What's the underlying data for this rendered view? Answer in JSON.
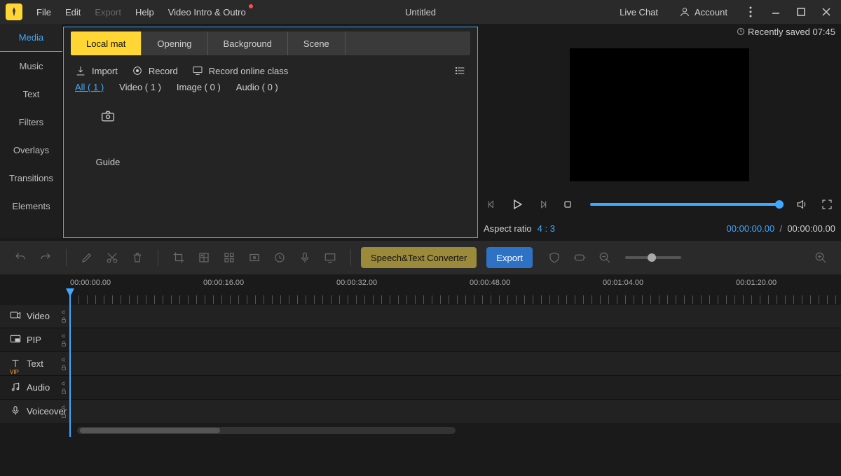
{
  "titlebar": {
    "title": "Untitled",
    "menus": [
      "File",
      "Edit",
      "Export",
      "Help",
      "Video Intro & Outro"
    ],
    "export_disabled": true,
    "live_chat": "Live Chat",
    "account": "Account",
    "saved": "Recently saved 07:45"
  },
  "sidebar": {
    "tabs": [
      "Media",
      "Music",
      "Text",
      "Filters",
      "Overlays",
      "Transitions",
      "Elements"
    ],
    "active": "Media"
  },
  "source_tabs": {
    "items": [
      "Local mat",
      "Opening",
      "Background",
      "Scene"
    ],
    "active": "Local mat"
  },
  "actions": {
    "import": "Import",
    "record": "Record",
    "record_online": "Record online class"
  },
  "filter_tabs": {
    "all": "All ( 1 )",
    "video": "Video ( 1 )",
    "image": "Image ( 0 )",
    "audio": "Audio ( 0 )"
  },
  "thumb": {
    "label": "Guide"
  },
  "preview": {
    "aspect_label": "Aspect ratio",
    "aspect_value": "4 : 3",
    "time_current": "00:00:00.00",
    "time_total": "00:00:00.00"
  },
  "toolbar": {
    "speech": "Speech&Text Converter",
    "export": "Export"
  },
  "ruler": [
    "00:00:00.00",
    "00:00:16.00",
    "00:00:32.00",
    "00:00:48.00",
    "00:01:04.00",
    "00:01:20.00"
  ],
  "tracks": [
    {
      "icon": "video",
      "label": "Video",
      "vip": false
    },
    {
      "icon": "pip",
      "label": "PIP",
      "vip": false
    },
    {
      "icon": "text",
      "label": "Text",
      "vip": true
    },
    {
      "icon": "audio",
      "label": "Audio",
      "vip": false
    },
    {
      "icon": "mic",
      "label": "Voiceover",
      "vip": false
    }
  ],
  "colors": {
    "accent": "#3fa9ff",
    "brand": "#ffd633"
  }
}
